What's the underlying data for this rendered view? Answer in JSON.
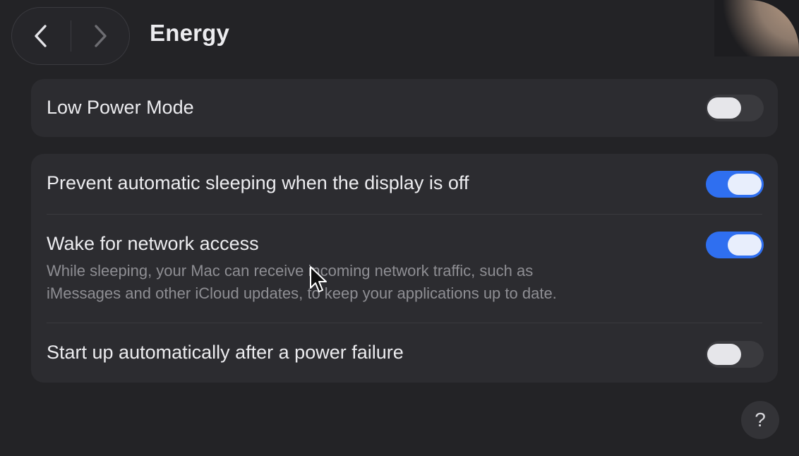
{
  "header": {
    "title": "Energy",
    "back_icon": "chevron-left-icon",
    "forward_icon": "chevron-right-icon"
  },
  "low_power": {
    "label": "Low Power Mode",
    "state": "off"
  },
  "settings": [
    {
      "label": "Prevent automatic sleeping when the display is off",
      "state": "on"
    },
    {
      "label": "Wake for network access",
      "description_line1": "While sleeping, your Mac can receive incoming network traffic, such as",
      "description_line2": "iMessages and other iCloud updates, to keep your applications up to date.",
      "state": "on"
    },
    {
      "label": "Start up automatically after a power failure",
      "state": "off"
    }
  ],
  "help": {
    "label": "?"
  },
  "colors": {
    "accent": "#2f6ff0",
    "background": "#232326",
    "group": "#2c2c30"
  }
}
